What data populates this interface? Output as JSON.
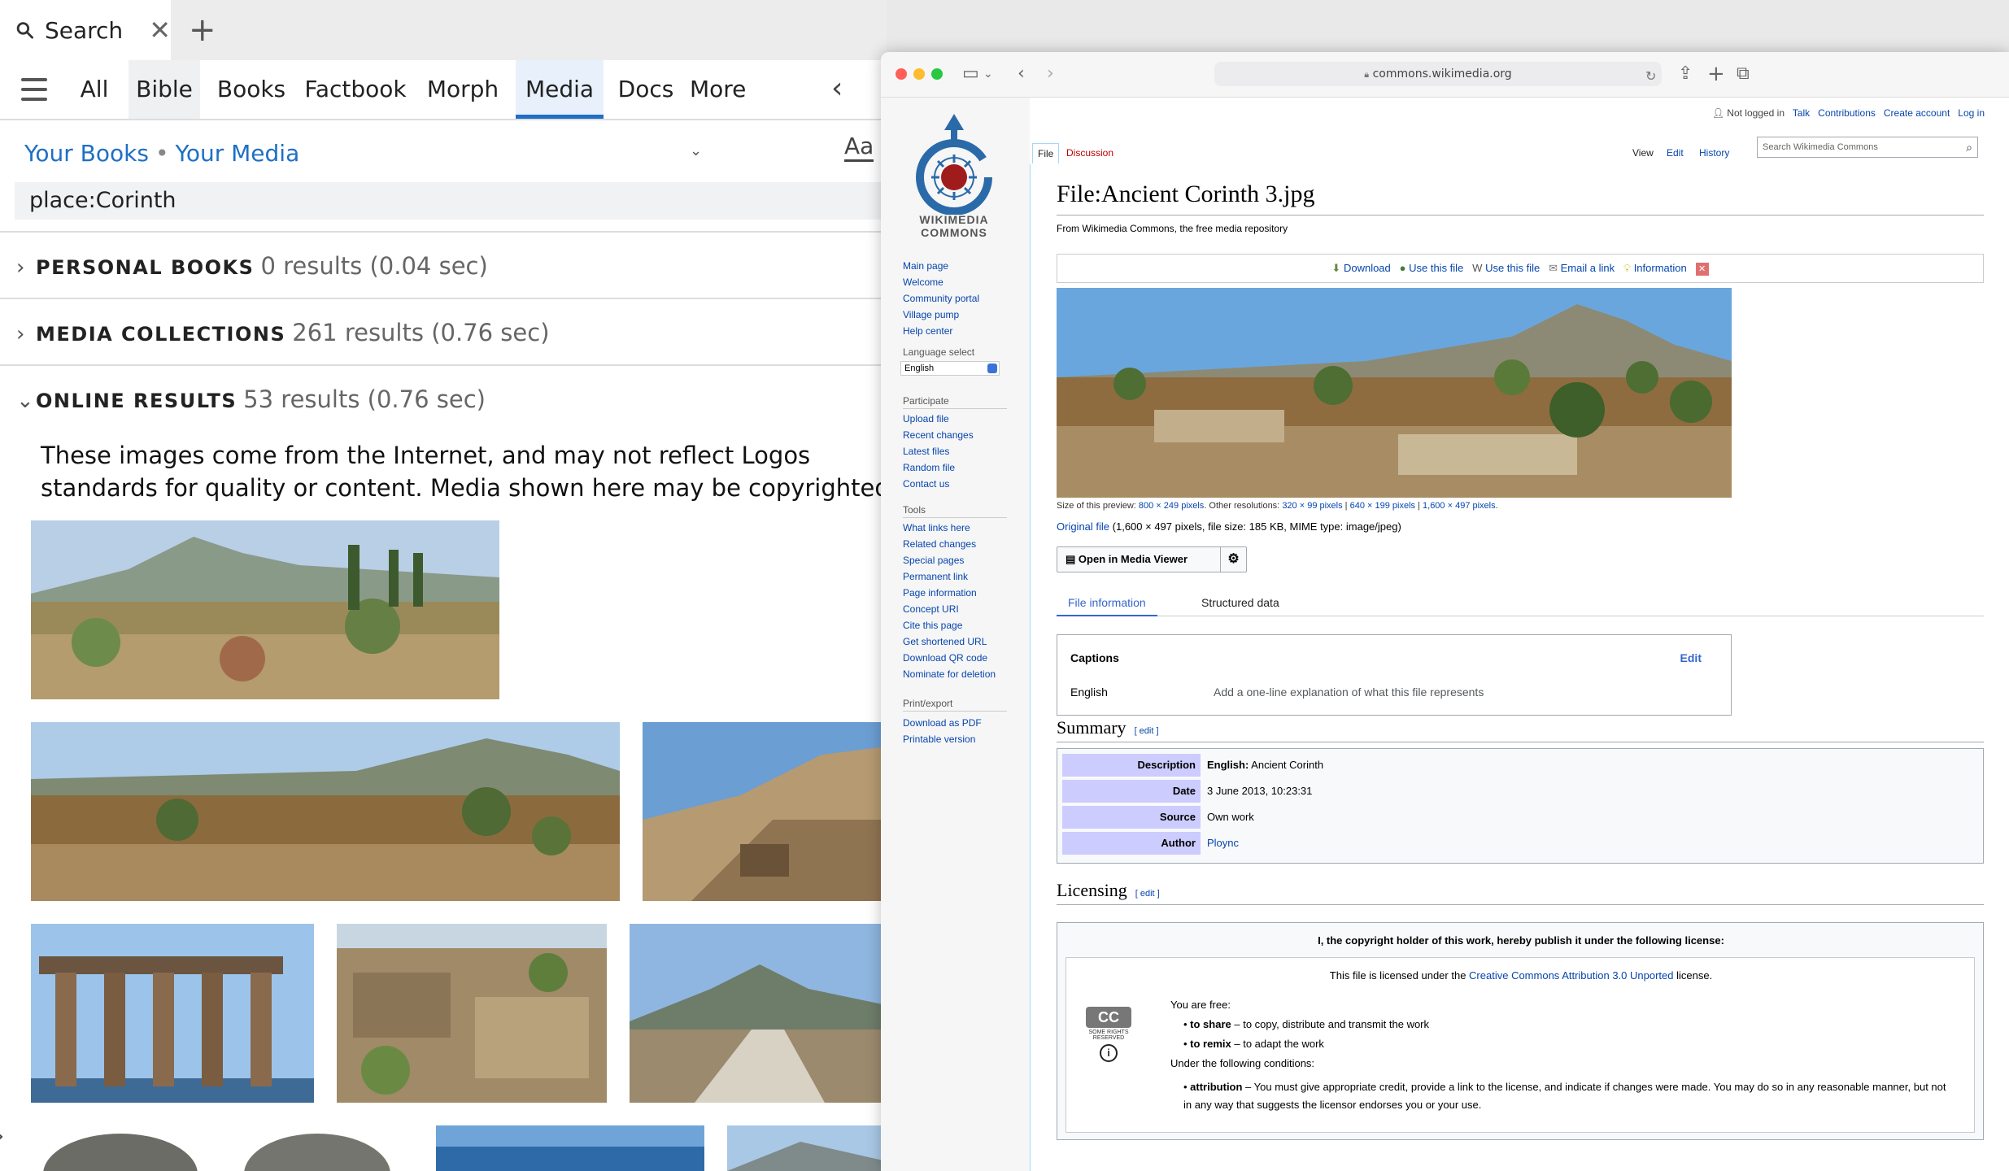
{
  "logos": {
    "tab": {
      "label": "Search"
    },
    "nav": {
      "items": [
        "All",
        "Bible",
        "Books",
        "Factbook",
        "Morph",
        "Media",
        "Docs",
        "More"
      ],
      "active": "Media"
    },
    "breadcrumb": {
      "books": "Your Books",
      "separator": "•",
      "media": "Your Media"
    },
    "aa_label": "Aa",
    "search_value": "place:Corinth",
    "sections": [
      {
        "title": "PERSONAL BOOKS",
        "count": "0 results (0.04 sec)",
        "expanded": false
      },
      {
        "title": "MEDIA COLLECTIONS",
        "count": "261 results (0.76 sec)",
        "expanded": false
      },
      {
        "title": "ONLINE RESULTS",
        "count": "53 results (0.76 sec)",
        "expanded": true
      }
    ],
    "disclaimer": "These images come from the Internet, and may not reflect Logos standards for quality or content. Media shown here may be copyrighted."
  },
  "safari": {
    "url": "commons.wikimedia.org"
  },
  "wiki": {
    "logo_line1": "WIKIMEDIA",
    "logo_line2": "COMMONS",
    "user_links": {
      "not_logged": "Not logged in",
      "talk": "Talk",
      "contributions": "Contributions",
      "create": "Create account",
      "login": "Log in"
    },
    "tabs": {
      "file": "File",
      "discussion": "Discussion",
      "view": "View",
      "edit": "Edit",
      "history": "History"
    },
    "search_placeholder": "Search Wikimedia Commons",
    "sidebar": {
      "main": [
        "Main page",
        "Welcome",
        "Community portal",
        "Village pump",
        "Help center"
      ],
      "lang_head": "Language select",
      "lang_value": "English",
      "participate_head": "Participate",
      "participate": [
        "Upload file",
        "Recent changes",
        "Latest files",
        "Random file",
        "Contact us"
      ],
      "tools_head": "Tools",
      "tools": [
        "What links here",
        "Related changes",
        "Special pages",
        "Permanent link",
        "Page information",
        "Concept URI",
        "Cite this page",
        "Get shortened URL",
        "Download QR code",
        "Nominate for deletion"
      ],
      "print_head": "Print/export",
      "print": [
        "Download as PDF",
        "Printable version"
      ]
    },
    "title": "File:Ancient Corinth 3.jpg",
    "from": "From Wikimedia Commons, the free media repository",
    "actions": [
      "Download",
      "Use this file",
      "Use this file",
      "Email a link",
      "Information"
    ],
    "sizes": {
      "prefix": "Size of this preview:",
      "preview": "800 × 249 pixels",
      "other": ". Other resolutions:",
      "r1": "320 × 99 pixels",
      "r2": "640 × 199 pixels",
      "r3": "1,600 × 497 pixels",
      "sep": " | ",
      "end": "."
    },
    "original": {
      "link": "Original file",
      "details": " (1,600 × 497 pixels, file size: 185 KB, MIME type: image/jpeg)"
    },
    "media_viewer": "Open in Media Viewer",
    "info_tabs": {
      "file_info": "File information",
      "structured": "Structured data"
    },
    "captions": {
      "head": "Captions",
      "edit": "Edit",
      "lang": "English",
      "placeholder": "Add a one-line explanation of what this file represents"
    },
    "summary": {
      "heading": "Summary",
      "edit": "[ edit ]",
      "rows": [
        {
          "k": "Description",
          "v_bold": "English:",
          "v": " Ancient Corinth"
        },
        {
          "k": "Date",
          "v_bold": "",
          "v": "3 June 2013, 10:23:31"
        },
        {
          "k": "Source",
          "v_bold": "",
          "v": "Own work"
        },
        {
          "k": "Author",
          "v_bold": "",
          "v": "Ploync"
        }
      ]
    },
    "licensing": {
      "heading": "Licensing",
      "edit": "[ edit ]",
      "header": "I, the copyright holder of this work, hereby publish it under the following license:",
      "licensed_pre": "This file is licensed under the ",
      "licensed_link": "Creative Commons Attribution 3.0 Unported",
      "licensed_post": " license.",
      "free": "You are free:",
      "share_b": "to share",
      "share": " – to copy, distribute and transmit the work",
      "remix_b": "to remix",
      "remix": " – to adapt the work",
      "conditions": "Under the following conditions:",
      "attr_b": "attribution",
      "attr": " – You must give appropriate credit, provide a link to the license, and indicate if changes were made. You may do so in any reasonable manner, but not in any way that suggests the licensor endorses you or your use.",
      "cc_small": "SOME RIGHTS RESERVED"
    }
  }
}
